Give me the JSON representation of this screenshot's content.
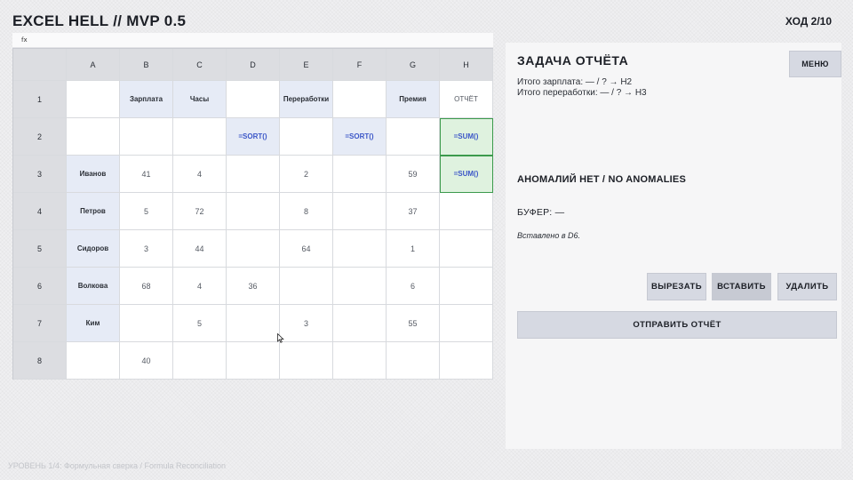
{
  "app": {
    "title": "EXCEL HELL // MVP 0.5",
    "turn": "ХОД 2/10"
  },
  "formula_bar": {
    "label": "fx"
  },
  "sheet": {
    "columns": [
      "A",
      "B",
      "C",
      "D",
      "E",
      "F",
      "G",
      "H"
    ],
    "rows": [
      {
        "num": "1",
        "cells": [
          {
            "v": "",
            "t": "plain"
          },
          {
            "v": "Зарплата",
            "t": "lbl"
          },
          {
            "v": "Часы",
            "t": "lbl"
          },
          {
            "v": "",
            "t": "plain"
          },
          {
            "v": "Переработки",
            "t": "lbl"
          },
          {
            "v": "",
            "t": "plain"
          },
          {
            "v": "Премия",
            "t": "lbl"
          },
          {
            "v": "ОТЧЁТ",
            "t": "plain-hdr"
          }
        ]
      },
      {
        "num": "2",
        "cells": [
          {
            "v": "",
            "t": "plain"
          },
          {
            "v": "",
            "t": "plain"
          },
          {
            "v": "",
            "t": "plain"
          },
          {
            "v": "=SORT()",
            "t": "formula"
          },
          {
            "v": "",
            "t": "plain"
          },
          {
            "v": "=SORT()",
            "t": "formula"
          },
          {
            "v": "",
            "t": "plain"
          },
          {
            "v": "=SUM()",
            "t": "sel"
          }
        ]
      },
      {
        "num": "3",
        "cells": [
          {
            "v": "Иванов",
            "t": "lbl"
          },
          {
            "v": "41",
            "t": "plain"
          },
          {
            "v": "4",
            "t": "plain"
          },
          {
            "v": "",
            "t": "plain"
          },
          {
            "v": "2",
            "t": "plain"
          },
          {
            "v": "",
            "t": "plain"
          },
          {
            "v": "59",
            "t": "plain"
          },
          {
            "v": "=SUM()",
            "t": "sel"
          }
        ]
      },
      {
        "num": "4",
        "cells": [
          {
            "v": "Петров",
            "t": "lbl"
          },
          {
            "v": "5",
            "t": "plain"
          },
          {
            "v": "72",
            "t": "plain"
          },
          {
            "v": "",
            "t": "plain"
          },
          {
            "v": "8",
            "t": "plain"
          },
          {
            "v": "",
            "t": "plain"
          },
          {
            "v": "37",
            "t": "plain"
          },
          {
            "v": "",
            "t": "plain"
          }
        ]
      },
      {
        "num": "5",
        "cells": [
          {
            "v": "Сидоров",
            "t": "lbl"
          },
          {
            "v": "3",
            "t": "plain"
          },
          {
            "v": "44",
            "t": "plain"
          },
          {
            "v": "",
            "t": "plain"
          },
          {
            "v": "64",
            "t": "plain"
          },
          {
            "v": "",
            "t": "plain"
          },
          {
            "v": "1",
            "t": "plain"
          },
          {
            "v": "",
            "t": "plain"
          }
        ]
      },
      {
        "num": "6",
        "cells": [
          {
            "v": "Волкова",
            "t": "lbl"
          },
          {
            "v": "68",
            "t": "plain"
          },
          {
            "v": "4",
            "t": "plain"
          },
          {
            "v": "36",
            "t": "plain"
          },
          {
            "v": "",
            "t": "plain"
          },
          {
            "v": "",
            "t": "plain"
          },
          {
            "v": "6",
            "t": "plain"
          },
          {
            "v": "",
            "t": "plain"
          }
        ]
      },
      {
        "num": "7",
        "cells": [
          {
            "v": "Ким",
            "t": "lbl"
          },
          {
            "v": "",
            "t": "plain"
          },
          {
            "v": "5",
            "t": "plain"
          },
          {
            "v": "",
            "t": "plain"
          },
          {
            "v": "3",
            "t": "plain"
          },
          {
            "v": "",
            "t": "plain"
          },
          {
            "v": "55",
            "t": "plain"
          },
          {
            "v": "",
            "t": "plain"
          }
        ]
      },
      {
        "num": "8",
        "cells": [
          {
            "v": "",
            "t": "plain"
          },
          {
            "v": "40",
            "t": "plain"
          },
          {
            "v": "",
            "t": "plain"
          },
          {
            "v": "",
            "t": "plain"
          },
          {
            "v": "",
            "t": "plain"
          },
          {
            "v": "",
            "t": "plain"
          },
          {
            "v": "",
            "t": "plain"
          },
          {
            "v": "",
            "t": "plain"
          }
        ]
      }
    ]
  },
  "panel": {
    "title": "ЗАДАЧА ОТЧЁТА",
    "task_lines": [
      "Итого зарплата: — / ? → H2",
      "Итого переработки: — / ? → H3"
    ],
    "menu_label": "МЕНЮ",
    "anomaly_text": "АНОМАЛИЙ НЕТ / NO ANOMALIES",
    "buffer_text": "БУФЕР: —",
    "status_text": "Вставлено в D6.",
    "buttons": {
      "cut": "ВЫРЕЗАТЬ",
      "paste": "ВСТАВИТЬ",
      "delete": "УДАЛИТЬ",
      "submit": "ОТПРАВИТЬ ОТЧЁТ"
    }
  },
  "footer": {
    "level_text": "УРОВЕНЬ 1/4: Формульная сверка  /  Formula Reconciliation"
  },
  "colors": {
    "label_fill": "#e6ebf6",
    "formula_text": "#3c57c8",
    "selected_fill": "#dff2df",
    "selected_border": "#3c9a4c"
  }
}
